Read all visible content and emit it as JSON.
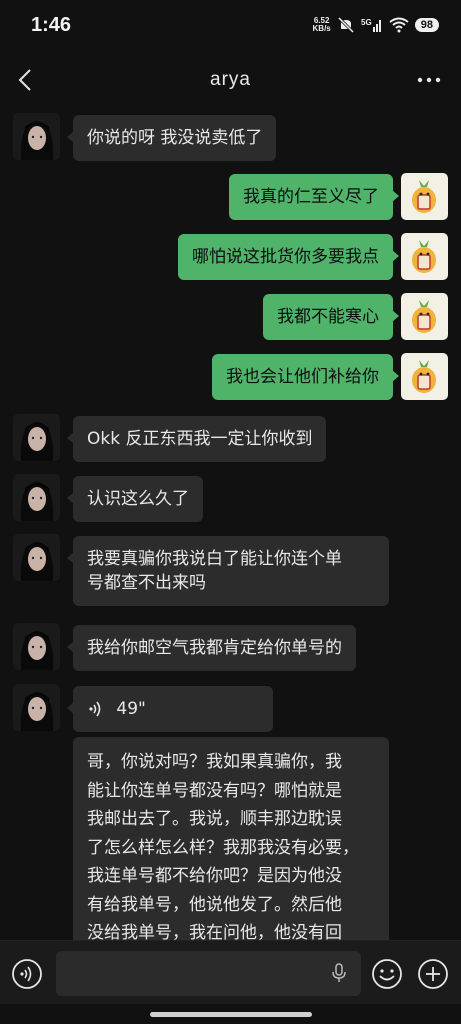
{
  "status_bar": {
    "time": "1:46",
    "net_speed_value": "6.52",
    "net_speed_unit": "KB/s",
    "battery": "98"
  },
  "nav": {
    "title": "arya"
  },
  "messages": [
    {
      "side": "left",
      "text": "你说的呀 我没说卖低了"
    },
    {
      "side": "right",
      "text": "我真的仁至义尽了"
    },
    {
      "side": "right",
      "text": "哪怕说这批货你多要我点"
    },
    {
      "side": "right",
      "text": "我都不能寒心"
    },
    {
      "side": "right",
      "text": "我也会让他们补给你"
    },
    {
      "side": "left",
      "text": "Okk 反正东西我一定让你收到"
    },
    {
      "side": "left",
      "text": "认识这么久了"
    },
    {
      "side": "left",
      "line1": "我要真骗你我说白了能让你连个单",
      "line2": "号都查不出来吗"
    },
    {
      "side": "left",
      "text": "我给你邮空气我都肯定给你单号的"
    },
    {
      "side": "left",
      "type": "voice",
      "duration": "49\""
    },
    {
      "side": "left",
      "type": "transcript",
      "lines": [
        "哥，你说对吗？我如果真骗你，我",
        "能让你连单号都没有吗？哪怕就是",
        "我邮出去了。我说，顺丰那边耽误",
        "了怎么样怎么样？我那我没有必要，",
        "我连单号都不给你吧？是因为他没",
        "有给我单号，他说他发了。然后他",
        "没给我单号，我在问他，他没有回"
      ]
    }
  ],
  "input": {
    "placeholder": ""
  },
  "colors": {
    "background": "#111111",
    "bubble_sent": "#4fb36a",
    "bubble_received": "#2c2c2c"
  }
}
